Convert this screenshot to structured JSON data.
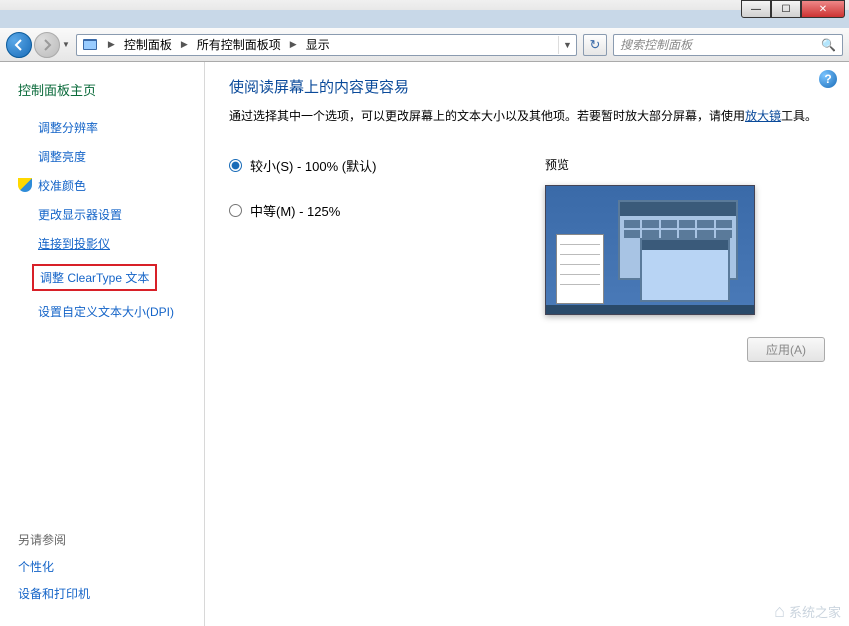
{
  "window_controls": {
    "min": "—",
    "max": "☐",
    "close": "✕"
  },
  "nav": {
    "breadcrumb": [
      "控制面板",
      "所有控制面板项",
      "显示"
    ],
    "search_placeholder": "搜索控制面板"
  },
  "sidebar": {
    "home": "控制面板主页",
    "links": [
      {
        "label": "调整分辨率",
        "icon": false,
        "underline": false,
        "highlight": false
      },
      {
        "label": "调整亮度",
        "icon": false,
        "underline": false,
        "highlight": false
      },
      {
        "label": "校准颜色",
        "icon": true,
        "underline": false,
        "highlight": false
      },
      {
        "label": "更改显示器设置",
        "icon": false,
        "underline": false,
        "highlight": false
      },
      {
        "label": "连接到投影仪",
        "icon": false,
        "underline": true,
        "highlight": false
      },
      {
        "label": "调整 ClearType 文本",
        "icon": false,
        "underline": false,
        "highlight": true
      },
      {
        "label": "设置自定义文本大小(DPI)",
        "icon": false,
        "underline": false,
        "highlight": false
      }
    ],
    "see_also": {
      "title": "另请参阅",
      "links": [
        "个性化",
        "设备和打印机"
      ]
    }
  },
  "content": {
    "title": "使阅读屏幕上的内容更容易",
    "desc_before": "通过选择其中一个选项，可以更改屏幕上的文本大小以及其他项。若要暂时放大部分屏幕，请使用",
    "desc_link": "放大镜",
    "desc_after": "工具。",
    "radios": [
      {
        "label": "较小(S) - 100% (默认)",
        "checked": true
      },
      {
        "label": "中等(M) - 125%",
        "checked": false
      }
    ],
    "preview_label": "预览",
    "apply_label": "应用(A)"
  },
  "watermark": "系统之家"
}
